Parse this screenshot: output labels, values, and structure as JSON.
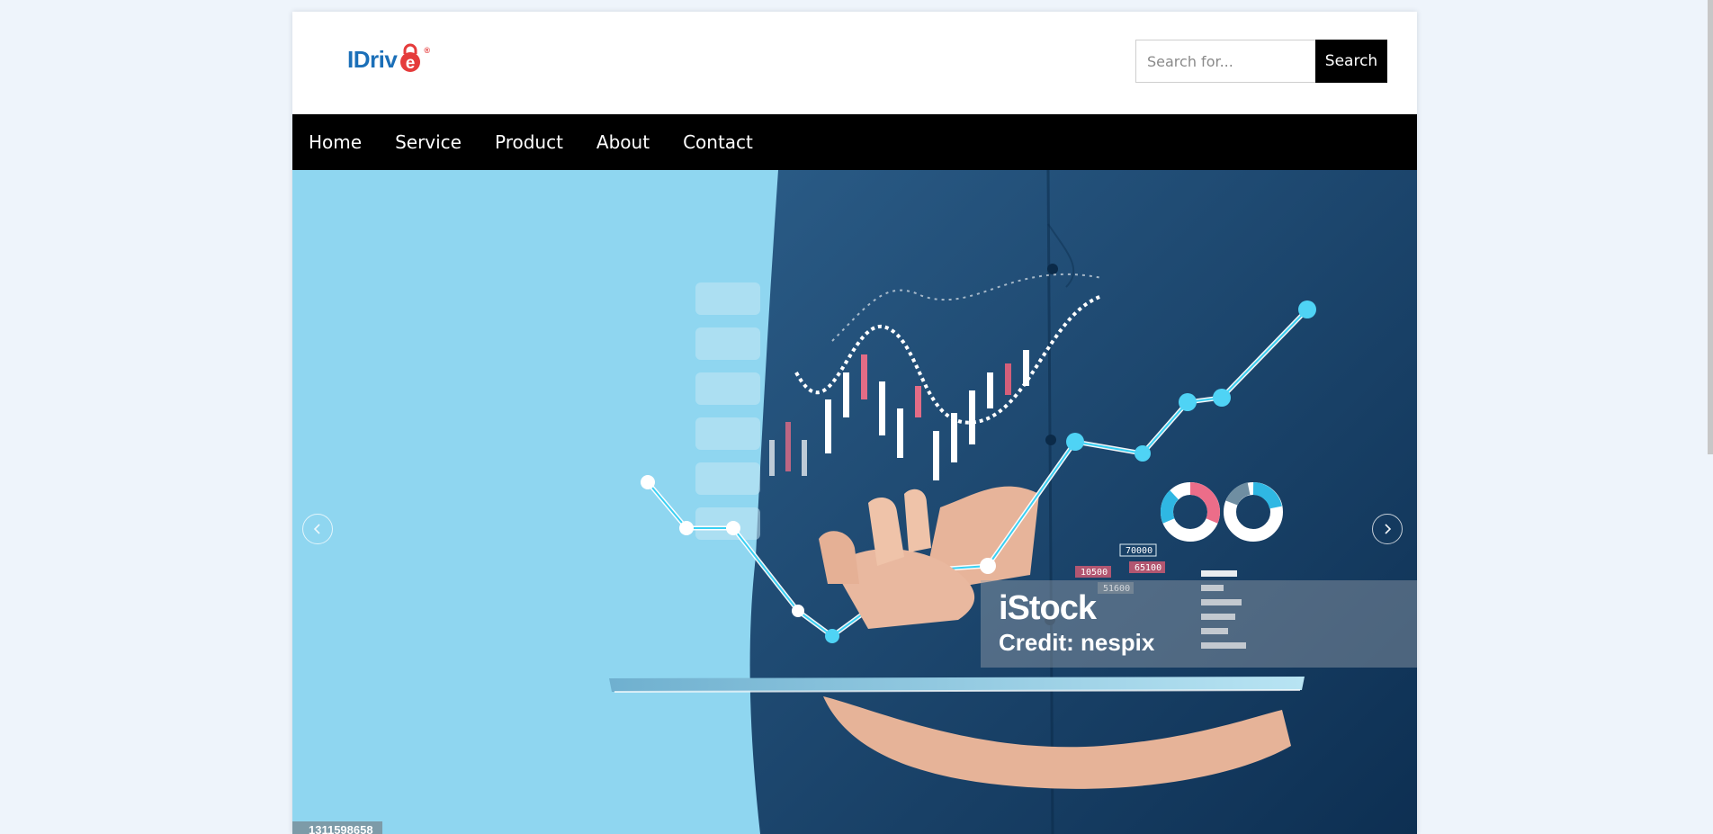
{
  "header": {
    "logo_text": "IDriv",
    "logo_mark": "e",
    "logo_reg": "®"
  },
  "search": {
    "placeholder": "Search for...",
    "button_label": "Search"
  },
  "nav": {
    "items": [
      {
        "label": "Home"
      },
      {
        "label": "Service"
      },
      {
        "label": "Product"
      },
      {
        "label": "About"
      },
      {
        "label": "Contact"
      }
    ]
  },
  "hero": {
    "credit_brand": "iStock",
    "credit_line": "Credit: nespix",
    "image_id": "1311598658",
    "chart_labels": [
      "70000",
      "10500",
      "65100",
      "51600"
    ],
    "icons": {
      "prev": "chevron-left-icon",
      "next": "chevron-right-icon"
    }
  },
  "colors": {
    "page_bg": "#eef4fb",
    "nav_bg": "#000000",
    "logo_blue": "#1b6fb8",
    "logo_red": "#e53b3b",
    "hero_bg": "#8fd6f0"
  }
}
